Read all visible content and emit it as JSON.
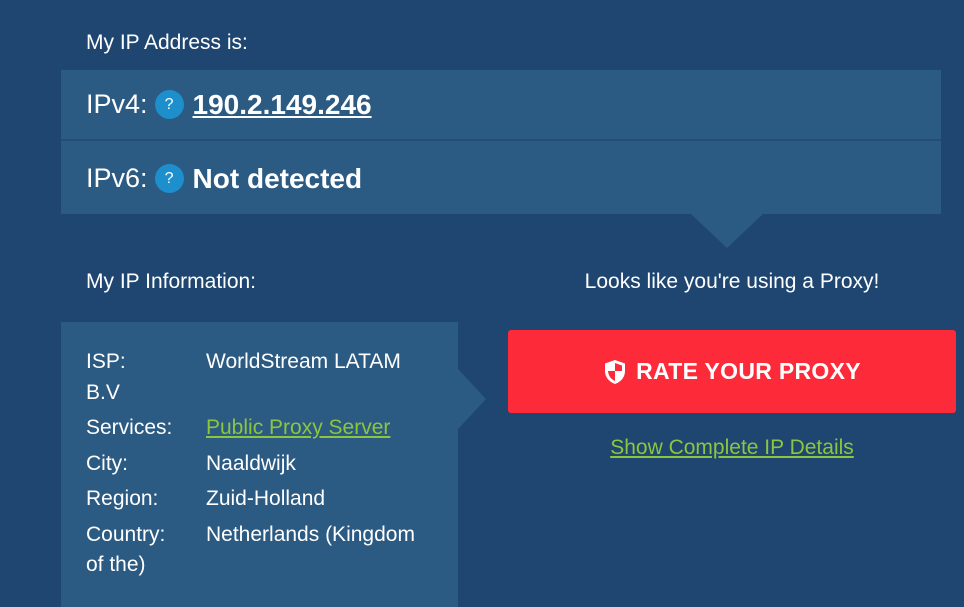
{
  "ip_section": {
    "heading": "My IP Address is:",
    "ipv4": {
      "label": "IPv4:",
      "help": "?",
      "value": "190.2.149.246"
    },
    "ipv6": {
      "label": "IPv6:",
      "help": "?",
      "value": "Not detected"
    }
  },
  "info_section": {
    "heading": "My IP Information:",
    "isp": {
      "key": "ISP:",
      "value_line1": "WorldStream LATAM",
      "value_line2": "B.V"
    },
    "services": {
      "key": "Services:",
      "value": "Public Proxy Server"
    },
    "city": {
      "key": "City:",
      "value": "Naaldwijk"
    },
    "region": {
      "key": "Region:",
      "value": "Zuid-Holland"
    },
    "country": {
      "key": "Country:",
      "value_line1": "Netherlands (Kingdom",
      "value_line2": "of the)"
    }
  },
  "proxy_section": {
    "message": "Looks like you're using a Proxy!",
    "rate_button": {
      "label": "RATE YOUR PROXY",
      "icon": "shield-icon"
    },
    "details_link": "Show Complete IP Details"
  },
  "colors": {
    "background": "#1e4670",
    "panel": "#2b5a82",
    "accent_red": "#fd2a3a",
    "link_green": "#8cc63e",
    "help_blue": "#1d8fcc"
  }
}
